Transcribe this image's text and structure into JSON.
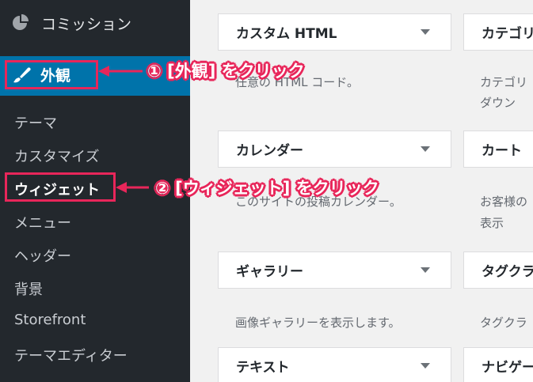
{
  "sidebar": {
    "top_item": {
      "label": "コミッション",
      "icon": "pie-chart-icon"
    },
    "active_menu": {
      "label": "外観",
      "icon": "paintbrush-icon"
    },
    "submenu": [
      {
        "label": "テーマ"
      },
      {
        "label": "カスタマイズ"
      },
      {
        "label": "ウィジェット"
      },
      {
        "label": "メニュー"
      },
      {
        "label": "ヘッダー"
      },
      {
        "label": "背景"
      },
      {
        "label": "Storefront"
      },
      {
        "label": "テーマエディター"
      }
    ]
  },
  "widgets": [
    {
      "title": "カスタム HTML",
      "desc": [
        "任意の HTML コード。"
      ]
    },
    {
      "title": "カテゴリ",
      "desc": [
        "カテゴリ",
        "ダウン"
      ]
    },
    {
      "title": "カレンダー",
      "desc": [
        "このサイトの投稿カレンダー。"
      ]
    },
    {
      "title": "カート",
      "desc": [
        "お客様の",
        "表示"
      ]
    },
    {
      "title": "ギャラリー",
      "desc": [
        "画像ギャラリーを表示します。"
      ]
    },
    {
      "title": "タグクラ",
      "desc": [
        "タグクラ"
      ]
    },
    {
      "title": "テキスト",
      "desc": []
    },
    {
      "title": "ナビゲー",
      "desc": []
    }
  ],
  "annotations": {
    "step1": "① [外観] をクリック",
    "step2": "② [ウィジェット] をクリック"
  },
  "colors": {
    "sidebar_bg": "#23282d",
    "active_bg": "#0073aa",
    "highlight": "#e8265a",
    "content_bg": "#f1f1f1"
  }
}
